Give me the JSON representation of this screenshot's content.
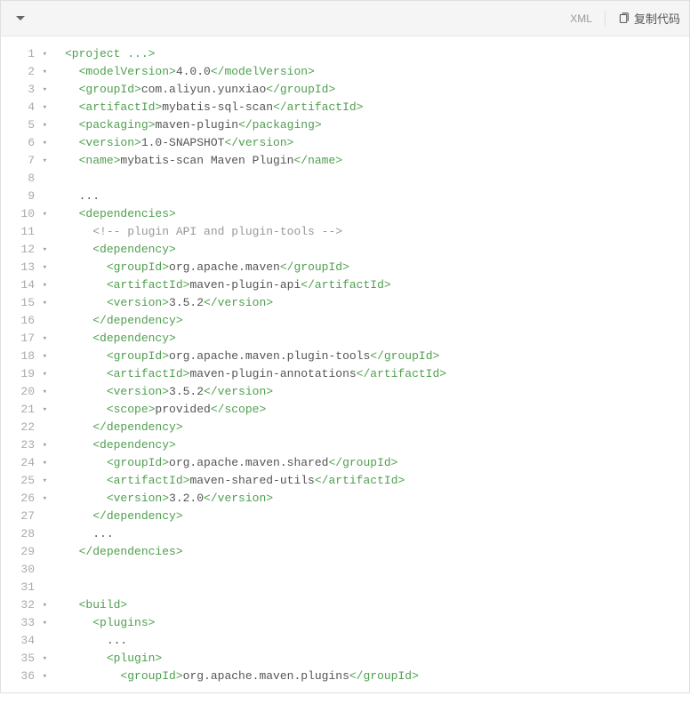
{
  "toolbar": {
    "language": "XML",
    "copy_label": "复制代码"
  },
  "lines": [
    {
      "n": 1,
      "fold": true,
      "indent": 0,
      "tokens": [
        {
          "t": "tag",
          "v": "<project "
        },
        {
          "t": "ellipsis",
          "v": "..."
        },
        {
          "t": "tag",
          "v": ">"
        }
      ]
    },
    {
      "n": 2,
      "fold": true,
      "indent": 1,
      "tokens": [
        {
          "t": "tag",
          "v": "<modelVersion>"
        },
        {
          "t": "text",
          "v": "4.0.0"
        },
        {
          "t": "tag",
          "v": "</modelVersion>"
        }
      ]
    },
    {
      "n": 3,
      "fold": true,
      "indent": 1,
      "tokens": [
        {
          "t": "tag",
          "v": "<groupId>"
        },
        {
          "t": "text",
          "v": "com.aliyun.yunxiao"
        },
        {
          "t": "tag",
          "v": "</groupId>"
        }
      ]
    },
    {
      "n": 4,
      "fold": true,
      "indent": 1,
      "tokens": [
        {
          "t": "tag",
          "v": "<artifactId>"
        },
        {
          "t": "text",
          "v": "mybatis-sql-scan"
        },
        {
          "t": "tag",
          "v": "</artifactId>"
        }
      ]
    },
    {
      "n": 5,
      "fold": true,
      "indent": 1,
      "tokens": [
        {
          "t": "tag",
          "v": "<packaging>"
        },
        {
          "t": "text",
          "v": "maven-plugin"
        },
        {
          "t": "tag",
          "v": "</packaging>"
        }
      ]
    },
    {
      "n": 6,
      "fold": true,
      "indent": 1,
      "tokens": [
        {
          "t": "tag",
          "v": "<version>"
        },
        {
          "t": "text",
          "v": "1.0-SNAPSHOT"
        },
        {
          "t": "tag",
          "v": "</version>"
        }
      ]
    },
    {
      "n": 7,
      "fold": true,
      "indent": 1,
      "tokens": [
        {
          "t": "tag",
          "v": "<name>"
        },
        {
          "t": "text",
          "v": "mybatis-scan Maven Plugin"
        },
        {
          "t": "tag",
          "v": "</name>"
        }
      ]
    },
    {
      "n": 8,
      "fold": false,
      "indent": 0,
      "tokens": []
    },
    {
      "n": 9,
      "fold": false,
      "indent": 1,
      "tokens": [
        {
          "t": "text",
          "v": "..."
        }
      ]
    },
    {
      "n": 10,
      "fold": true,
      "indent": 1,
      "tokens": [
        {
          "t": "tag",
          "v": "<dependencies>"
        }
      ]
    },
    {
      "n": 11,
      "fold": false,
      "indent": 2,
      "tokens": [
        {
          "t": "comment",
          "v": "<!-- plugin API and plugin-tools -->"
        }
      ]
    },
    {
      "n": 12,
      "fold": true,
      "indent": 2,
      "tokens": [
        {
          "t": "tag",
          "v": "<dependency>"
        }
      ]
    },
    {
      "n": 13,
      "fold": true,
      "indent": 3,
      "tokens": [
        {
          "t": "tag",
          "v": "<groupId>"
        },
        {
          "t": "text",
          "v": "org.apache.maven"
        },
        {
          "t": "tag",
          "v": "</groupId>"
        }
      ]
    },
    {
      "n": 14,
      "fold": true,
      "indent": 3,
      "tokens": [
        {
          "t": "tag",
          "v": "<artifactId>"
        },
        {
          "t": "text",
          "v": "maven-plugin-api"
        },
        {
          "t": "tag",
          "v": "</artifactId>"
        }
      ]
    },
    {
      "n": 15,
      "fold": true,
      "indent": 3,
      "tokens": [
        {
          "t": "tag",
          "v": "<version>"
        },
        {
          "t": "text",
          "v": "3.5.2"
        },
        {
          "t": "tag",
          "v": "</version>"
        }
      ]
    },
    {
      "n": 16,
      "fold": false,
      "indent": 2,
      "tokens": [
        {
          "t": "tag",
          "v": "</dependency>"
        }
      ]
    },
    {
      "n": 17,
      "fold": true,
      "indent": 2,
      "tokens": [
        {
          "t": "tag",
          "v": "<dependency>"
        }
      ]
    },
    {
      "n": 18,
      "fold": true,
      "indent": 3,
      "tokens": [
        {
          "t": "tag",
          "v": "<groupId>"
        },
        {
          "t": "text",
          "v": "org.apache.maven.plugin-tools"
        },
        {
          "t": "tag",
          "v": "</groupId>"
        }
      ]
    },
    {
      "n": 19,
      "fold": true,
      "indent": 3,
      "tokens": [
        {
          "t": "tag",
          "v": "<artifactId>"
        },
        {
          "t": "text",
          "v": "maven-plugin-annotations"
        },
        {
          "t": "tag",
          "v": "</artifactId>"
        }
      ]
    },
    {
      "n": 20,
      "fold": true,
      "indent": 3,
      "tokens": [
        {
          "t": "tag",
          "v": "<version>"
        },
        {
          "t": "text",
          "v": "3.5.2"
        },
        {
          "t": "tag",
          "v": "</version>"
        }
      ]
    },
    {
      "n": 21,
      "fold": true,
      "indent": 3,
      "tokens": [
        {
          "t": "tag",
          "v": "<scope>"
        },
        {
          "t": "text",
          "v": "provided"
        },
        {
          "t": "tag",
          "v": "</scope>"
        }
      ]
    },
    {
      "n": 22,
      "fold": false,
      "indent": 2,
      "tokens": [
        {
          "t": "tag",
          "v": "</dependency>"
        }
      ]
    },
    {
      "n": 23,
      "fold": true,
      "indent": 2,
      "tokens": [
        {
          "t": "tag",
          "v": "<dependency>"
        }
      ]
    },
    {
      "n": 24,
      "fold": true,
      "indent": 3,
      "tokens": [
        {
          "t": "tag",
          "v": "<groupId>"
        },
        {
          "t": "text",
          "v": "org.apache.maven.shared"
        },
        {
          "t": "tag",
          "v": "</groupId>"
        }
      ]
    },
    {
      "n": 25,
      "fold": true,
      "indent": 3,
      "tokens": [
        {
          "t": "tag",
          "v": "<artifactId>"
        },
        {
          "t": "text",
          "v": "maven-shared-utils"
        },
        {
          "t": "tag",
          "v": "</artifactId>"
        }
      ]
    },
    {
      "n": 26,
      "fold": true,
      "indent": 3,
      "tokens": [
        {
          "t": "tag",
          "v": "<version>"
        },
        {
          "t": "text",
          "v": "3.2.0"
        },
        {
          "t": "tag",
          "v": "</version>"
        }
      ]
    },
    {
      "n": 27,
      "fold": false,
      "indent": 2,
      "tokens": [
        {
          "t": "tag",
          "v": "</dependency>"
        }
      ]
    },
    {
      "n": 28,
      "fold": false,
      "indent": 2,
      "tokens": [
        {
          "t": "text",
          "v": "..."
        }
      ]
    },
    {
      "n": 29,
      "fold": false,
      "indent": 1,
      "tokens": [
        {
          "t": "tag",
          "v": "</dependencies>"
        }
      ]
    },
    {
      "n": 30,
      "fold": false,
      "indent": 0,
      "tokens": []
    },
    {
      "n": 31,
      "fold": false,
      "indent": 0,
      "tokens": []
    },
    {
      "n": 32,
      "fold": true,
      "indent": 1,
      "tokens": [
        {
          "t": "tag",
          "v": "<build>"
        }
      ]
    },
    {
      "n": 33,
      "fold": true,
      "indent": 2,
      "tokens": [
        {
          "t": "tag",
          "v": "<plugins>"
        }
      ]
    },
    {
      "n": 34,
      "fold": false,
      "indent": 3,
      "tokens": [
        {
          "t": "text",
          "v": "..."
        }
      ]
    },
    {
      "n": 35,
      "fold": true,
      "indent": 3,
      "tokens": [
        {
          "t": "tag",
          "v": "<plugin>"
        }
      ]
    },
    {
      "n": 36,
      "fold": true,
      "indent": 4,
      "tokens": [
        {
          "t": "tag",
          "v": "<groupId>"
        },
        {
          "t": "text",
          "v": "org.apache.maven.plugins"
        },
        {
          "t": "tag",
          "v": "</groupId>"
        }
      ]
    }
  ]
}
